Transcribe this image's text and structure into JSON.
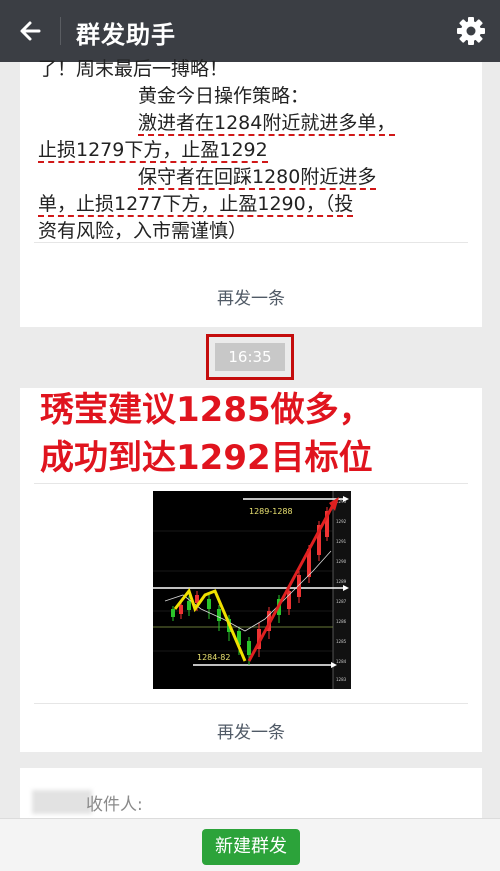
{
  "header": {
    "title": "群发助手",
    "back_icon": "arrow-left-icon",
    "settings_icon": "gear-icon"
  },
  "message": {
    "lines": [
      "了！周末最后一搏略！",
      "黄金今日操作策略：",
      "激进者在1284附近就进多单，",
      "止损1279下方，止盈1292",
      "保守者在回踩1280附近进多",
      "单，止损1277下方，止盈1290，（投",
      "资有风险，入市需谨慎）"
    ],
    "resend_label": "再发一条"
  },
  "timestamp": "16:35",
  "image_post": {
    "headline_1": "琇莹建议1285做多，",
    "headline_2": "成功到达1292目标位",
    "chart_labels": {
      "top": "1289-1288",
      "bottom": "1284-82"
    },
    "resend_label": "再发一条"
  },
  "recipients": {
    "label": "收件人:"
  },
  "footer": {
    "new_button": "新建群发"
  },
  "colors": {
    "header": "#3b3e44",
    "accent_red": "#e0141e",
    "button_green": "#2ca33a"
  }
}
